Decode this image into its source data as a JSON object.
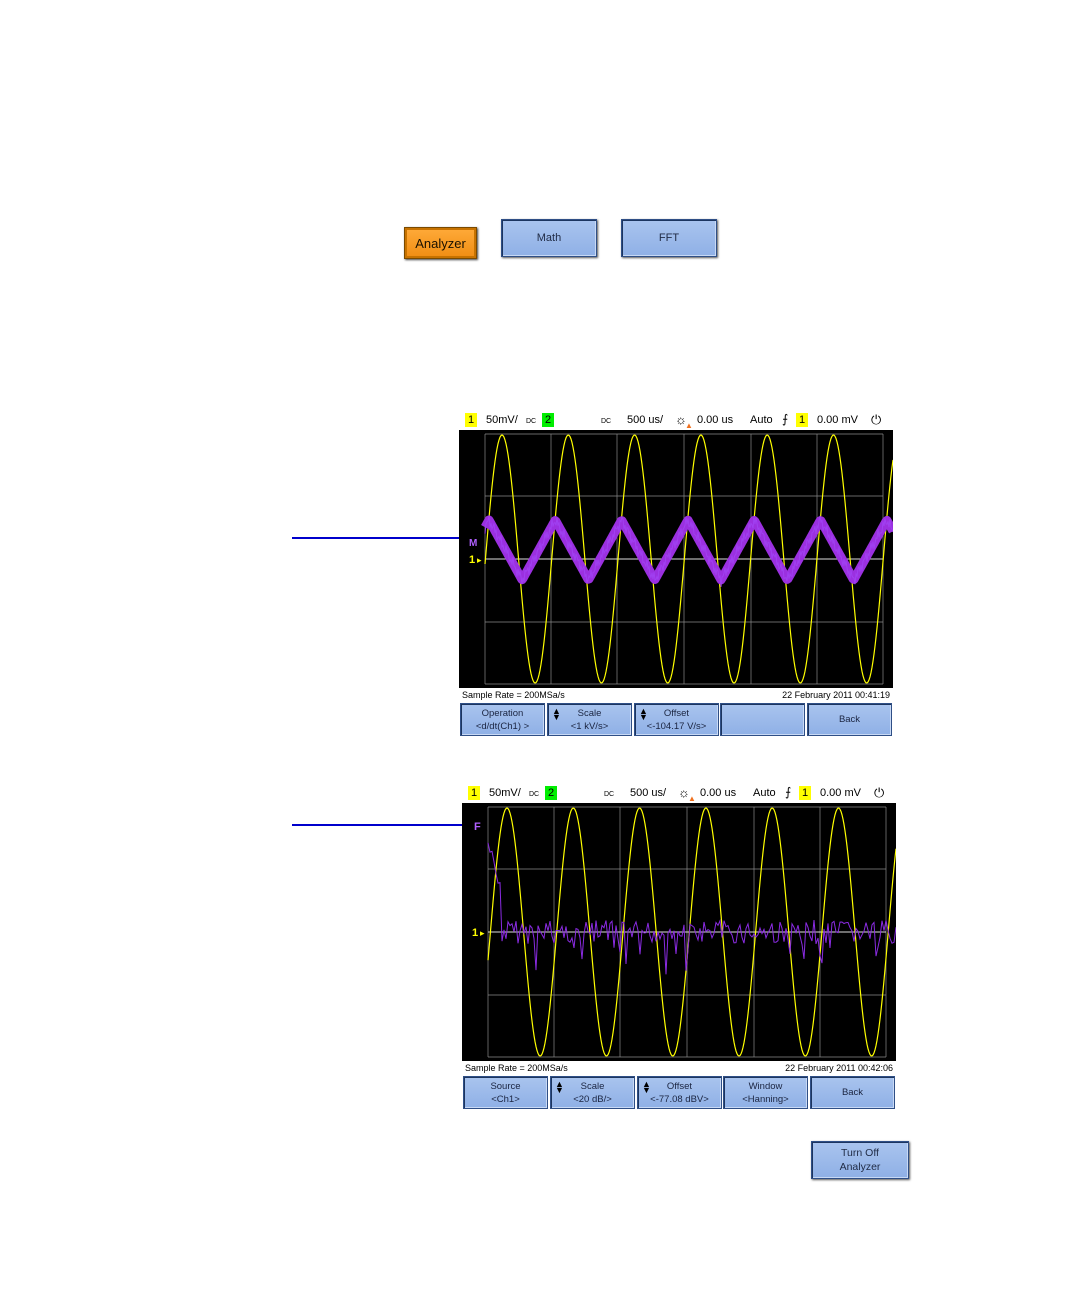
{
  "top_buttons": {
    "analyzer": "Analyzer",
    "math": "Math",
    "fft": "FFT"
  },
  "scope1": {
    "ch1_badge": "1",
    "ch1_scale": "50mV/",
    "ch1_coupling": "DC",
    "ch2_badge": "2",
    "ch2_coupling": "DC",
    "timebase": "500 us/",
    "delay": "0.00 us",
    "trigger_mode": "Auto",
    "trig_source": "1",
    "trig_level": "0.00 mV",
    "ch1_marker": "1",
    "math_marker": "M",
    "sample_rate": "Sample Rate = 200MSa/s",
    "datetime": "22 February 2011  00:41:19",
    "softkeys": [
      {
        "l1": "Operation",
        "l2": "<d/dt(Ch1) >",
        "updown": false
      },
      {
        "l1": "Scale",
        "l2": "<1 kV/s>",
        "updown": true
      },
      {
        "l1": "Offset",
        "l2": "<-104.17 V/s>",
        "updown": true
      },
      {
        "l1": "",
        "l2": "",
        "updown": false
      },
      {
        "l1": "Back",
        "l2": "",
        "updown": false
      }
    ]
  },
  "scope2": {
    "ch1_badge": "1",
    "ch1_scale": "50mV/",
    "ch1_coupling": "DC",
    "ch2_badge": "2",
    "ch2_coupling": "DC",
    "timebase": "500 us/",
    "delay": "0.00 us",
    "trigger_mode": "Auto",
    "trig_source": "1",
    "trig_level": "0.00 mV",
    "ch1_marker": "1",
    "fft_marker": "F",
    "sample_rate": "Sample Rate = 200MSa/s",
    "datetime": "22 February 2011  00:42:06",
    "softkeys": [
      {
        "l1": "Source",
        "l2": "<Ch1>",
        "updown": false
      },
      {
        "l1": "Scale",
        "l2": "<20 dB/>",
        "updown": true
      },
      {
        "l1": "Offset",
        "l2": "<-77.08 dBV>",
        "updown": true
      },
      {
        "l1": "Window",
        "l2": "<Hanning>",
        "updown": false
      },
      {
        "l1": "Back",
        "l2": "",
        "updown": false
      }
    ]
  },
  "turn_off": {
    "line1": "Turn Off",
    "line2": "Analyzer"
  },
  "colors": {
    "ch1": "#ffff00",
    "ch2": "#00ee00",
    "math": "#9b30e0",
    "fft": "#8a2be2",
    "softkey": "#9bb8ea",
    "accent": "#f5961e"
  },
  "icons": {
    "brightness": "sun-icon",
    "trigger_edge": "rising-edge-icon",
    "power": "power-plug-icon"
  }
}
